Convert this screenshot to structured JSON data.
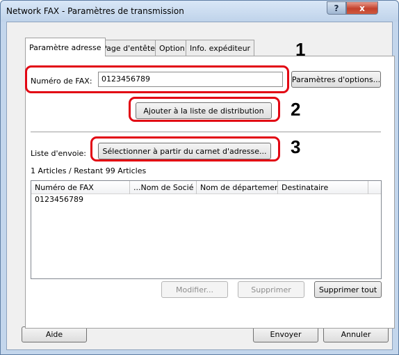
{
  "window": {
    "title": "Network FAX - Paramètres de transmission",
    "help_button": "?",
    "close_button": "x"
  },
  "tabs": [
    {
      "label": "Paramètre adresse",
      "active": true
    },
    {
      "label": "Page d'entête",
      "active": false
    },
    {
      "label": "Option",
      "active": false
    },
    {
      "label": "Info. expéditeur",
      "active": false
    }
  ],
  "fax_number": {
    "label": "Numéro de FAX:",
    "value": "0123456789"
  },
  "buttons": {
    "option_settings": "Paramètres d'options...",
    "add_to_distribution": "Ajouter à la liste de distribution",
    "select_from_address_book": "Sélectionner à partir du carnet d'adresse...",
    "modify": "Modifier...",
    "delete": "Supprimer",
    "delete_all": "Supprimer tout",
    "help": "Aide",
    "send": "Envoyer",
    "cancel": "Annuler"
  },
  "send_list": {
    "label": "Liste d'envoie:",
    "count_text": "1 Articles / Restant 99 Articles",
    "columns": [
      "Numéro de FAX",
      "...Nom de Socié",
      "Nom de département",
      "Destinataire"
    ],
    "rows": [
      [
        "0123456789",
        "",
        "",
        ""
      ]
    ]
  },
  "callouts": [
    "1",
    "2",
    "3"
  ],
  "colors": {
    "callout": "#e20613",
    "window_frame": "#c3d6ec",
    "close_button": "#c3412c"
  }
}
